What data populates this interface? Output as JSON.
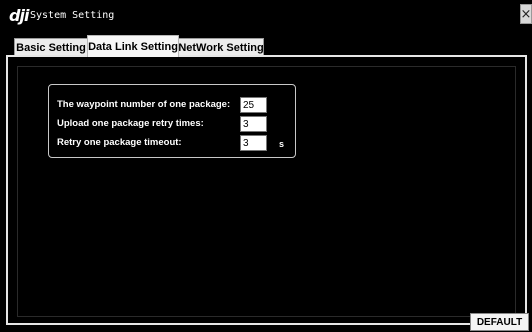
{
  "window": {
    "logo": "dji",
    "title": "System Setting",
    "close_label": "×"
  },
  "tabs": [
    {
      "label": "Basic Setting",
      "active": false
    },
    {
      "label": "Data Link Setting",
      "active": true
    },
    {
      "label": "NetWork Setting",
      "active": false
    }
  ],
  "settings": {
    "waypoint_label": "The waypoint number of one package:",
    "waypoint_value": "25",
    "retry_times_label": "Upload one package retry times:",
    "retry_times_value": "3",
    "timeout_label": "Retry one package timeout:",
    "timeout_value": "3",
    "timeout_unit": "s"
  },
  "buttons": {
    "default_label": "DEFAULT"
  }
}
